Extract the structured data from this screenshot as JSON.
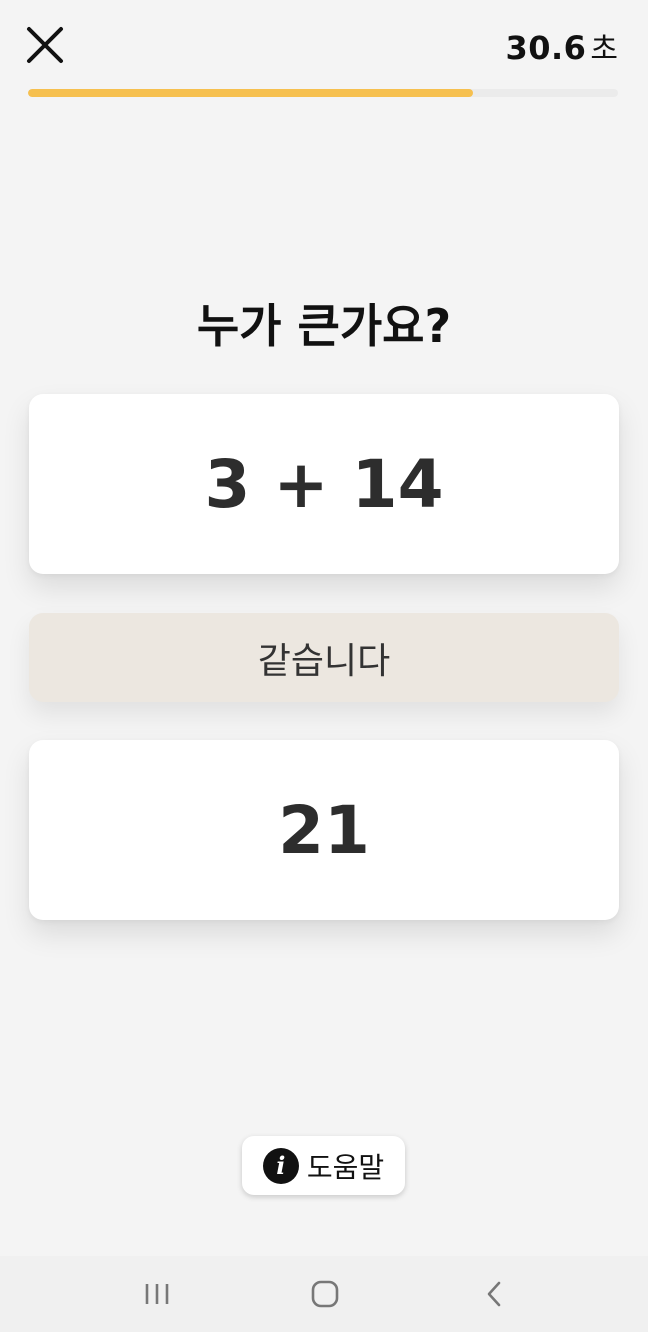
{
  "header": {
    "close_icon": "close-icon",
    "timer_value": "30.6",
    "timer_unit": "초",
    "progress_fraction": 0.755,
    "progress_color": "#f6c04f"
  },
  "quiz": {
    "question": "누가 큰가요?",
    "option_top": "3 + 14",
    "option_equal": "같습니다",
    "option_bottom": "21"
  },
  "help": {
    "icon": "info-icon",
    "label": "도움말"
  },
  "navbar": {
    "recent_icon": "recent-apps-icon",
    "home_icon": "home-icon",
    "back_icon": "back-icon"
  }
}
